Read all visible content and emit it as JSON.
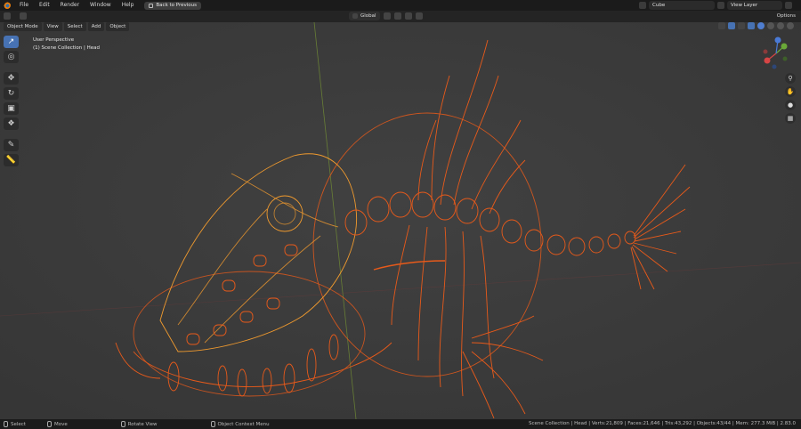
{
  "menu": {
    "items": [
      "File",
      "Edit",
      "Render",
      "Window",
      "Help"
    ],
    "back_button": "Back to Previous"
  },
  "scene": {
    "name": "Cube"
  },
  "view_layer": {
    "name": "View Layer"
  },
  "header": {
    "transform_orientation": "Global",
    "options": "Options"
  },
  "viewport_header": {
    "mode": "Object Mode",
    "menus": [
      "View",
      "Select",
      "Add",
      "Object"
    ]
  },
  "viewport": {
    "perspective": "User Perspective",
    "collection_info": "(1) Scene Collection | Head"
  },
  "statusbar": {
    "select": "Select",
    "move": "Move",
    "rotate": "Rotate View",
    "context_menu": "Object Context Menu",
    "stats": "Scene Collection | Head | Verts:21,809 | Faces:21,646 | Tris:43,292 | Objects:43/44 | Mem: 277.3 MiB | 2.83.0"
  },
  "colors": {
    "accent": "#4772b3",
    "wire_selected": "#e85a1a",
    "wire_active": "#f09a2e",
    "background": "#3d3d3d"
  }
}
